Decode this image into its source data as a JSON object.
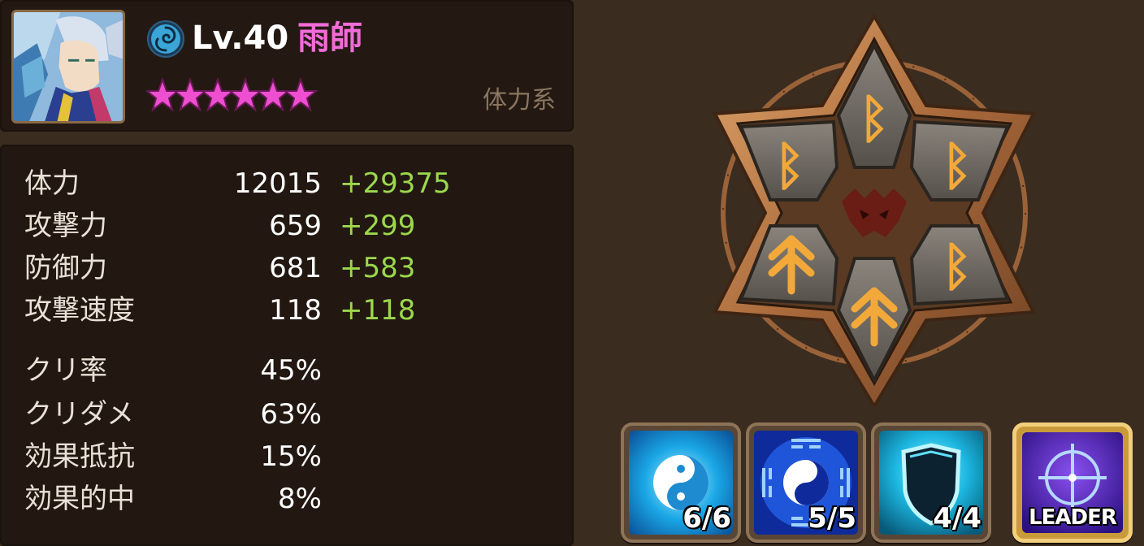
{
  "monster": {
    "level": "Lv.40",
    "name": "雨師",
    "type": "体力系",
    "element_icon": "wind-element-icon",
    "stars": 6,
    "star_color": "#ee4fd0"
  },
  "stats": [
    {
      "label": "体力",
      "base": "12015",
      "bonus": "+29375"
    },
    {
      "label": "攻撃力",
      "base": "659",
      "bonus": "+299"
    },
    {
      "label": "防御力",
      "base": "681",
      "bonus": "+583"
    },
    {
      "label": "攻撃速度",
      "base": "118",
      "bonus": "+118"
    },
    {
      "label": "クリ率",
      "base": "45%",
      "bonus": ""
    },
    {
      "label": "クリダメ",
      "base": "63%",
      "bonus": ""
    },
    {
      "label": "効果抵抗",
      "base": "15%",
      "bonus": ""
    },
    {
      "label": "効果的中",
      "base": "8%",
      "bonus": ""
    }
  ],
  "runes": {
    "set_icon": "vampire-set-icon",
    "slots": [
      "rune-rage-icon",
      "rune-rage-icon",
      "rune-rage-icon",
      "rune-fatal-icon",
      "rune-rage-icon",
      "rune-fatal-icon"
    ]
  },
  "skills": [
    {
      "level": "6/6",
      "icon": "yin-yang-skill-icon"
    },
    {
      "level": "5/5",
      "icon": "bagua-skill-icon"
    },
    {
      "level": "4/4",
      "icon": "shield-skill-icon"
    }
  ],
  "leader": {
    "label": "LEADER",
    "icon": "crosshair-leader-icon"
  },
  "colors": {
    "name_pink": "#f06cd8",
    "bonus_green": "#9bd84d",
    "type_brown": "#8a7560",
    "rune_glyph": "#f2a93a"
  }
}
